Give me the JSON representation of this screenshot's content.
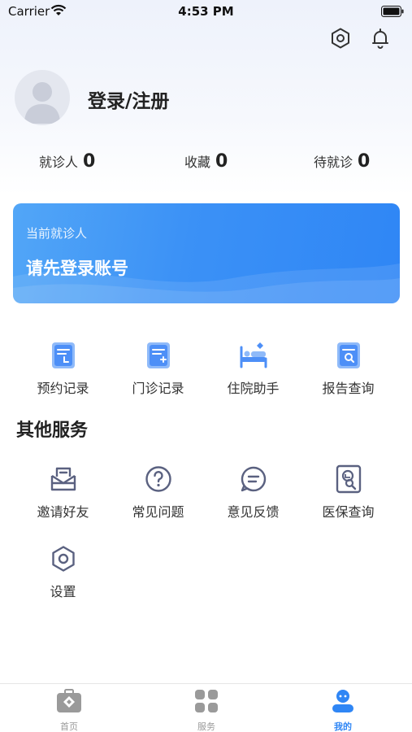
{
  "status_bar": {
    "carrier": "Carrier",
    "time": "4:53 PM"
  },
  "profile": {
    "login_label": "登录/注册"
  },
  "stats": [
    {
      "label": "就诊人",
      "count": "0"
    },
    {
      "label": "收藏",
      "count": "0"
    },
    {
      "label": "待就诊",
      "count": "0"
    }
  ],
  "patient_card": {
    "subtitle": "当前就诊人",
    "title": "请先登录账号"
  },
  "main_services": [
    {
      "label": "预约记录",
      "icon": "appointment-record-icon"
    },
    {
      "label": "门诊记录",
      "icon": "outpatient-record-icon"
    },
    {
      "label": "住院助手",
      "icon": "hospital-bed-icon"
    },
    {
      "label": "报告查询",
      "icon": "report-search-icon"
    }
  ],
  "other_services": {
    "title": "其他服务",
    "items": [
      {
        "label": "邀请好友",
        "icon": "invite-envelope-icon"
      },
      {
        "label": "常见问题",
        "icon": "question-icon"
      },
      {
        "label": "意见反馈",
        "icon": "feedback-icon"
      },
      {
        "label": "医保查询",
        "icon": "insurance-search-icon"
      },
      {
        "label": "设置",
        "icon": "settings-hexagon-icon"
      }
    ]
  },
  "tabbar": [
    {
      "label": "首页",
      "icon": "home-icon",
      "active": false
    },
    {
      "label": "服务",
      "icon": "service-grid-icon",
      "active": false
    },
    {
      "label": "我的",
      "icon": "profile-icon",
      "active": true
    }
  ],
  "colors": {
    "accent": "#2f86f5",
    "icon_line": "#5a6180",
    "icon_blue": "#4d8ff7"
  }
}
